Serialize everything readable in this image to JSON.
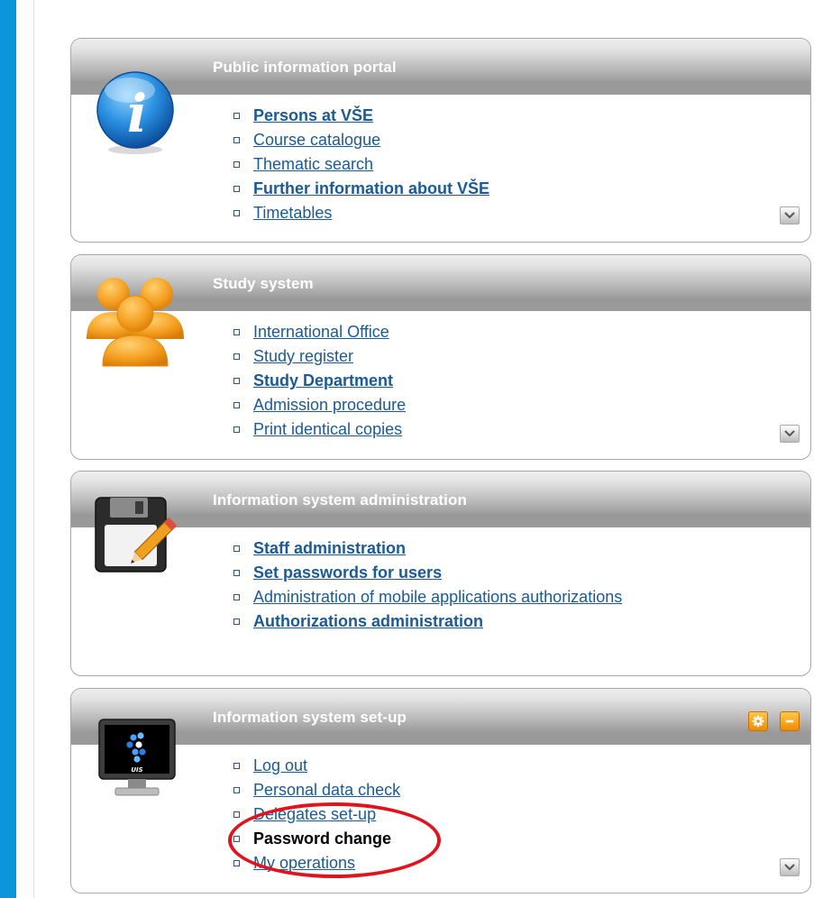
{
  "panels": [
    {
      "title": "Public information portal",
      "icon": "info-icon",
      "links": [
        {
          "label": "Persons at VŠE",
          "bold": true
        },
        {
          "label": "Course catalogue",
          "bold": false
        },
        {
          "label": "Thematic search",
          "bold": false
        },
        {
          "label": "Further information about VŠE",
          "bold": true
        },
        {
          "label": "Timetables",
          "bold": false
        }
      ]
    },
    {
      "title": "Study system",
      "icon": "users-icon",
      "links": [
        {
          "label": "International Office",
          "bold": false
        },
        {
          "label": "Study register",
          "bold": false
        },
        {
          "label": "Study Department",
          "bold": true
        },
        {
          "label": "Admission procedure",
          "bold": false
        },
        {
          "label": "Print identical copies",
          "bold": false
        }
      ]
    },
    {
      "title": "Information system administration",
      "icon": "floppy-edit-icon",
      "links": [
        {
          "label": "Staff administration",
          "bold": true
        },
        {
          "label": "Set passwords for users",
          "bold": true
        },
        {
          "label": "Administration of mobile applications authorizations",
          "bold": false
        },
        {
          "label": "Authorizations administration",
          "bold": true
        }
      ]
    },
    {
      "title": "Information system set-up",
      "icon": "monitor-is-icon",
      "monitor_text": "UIS",
      "links": [
        {
          "label": "Log out",
          "bold": false
        },
        {
          "label": "Personal data check",
          "bold": false
        },
        {
          "label": "Delegates set-up",
          "bold": false
        },
        {
          "label": "Password change",
          "bold": true,
          "current": true
        },
        {
          "label": "My operations",
          "bold": false
        }
      ]
    }
  ],
  "colors": {
    "page_background": "#0b96dc",
    "link": "#1a5a96",
    "header_text": "#ffffff",
    "highlight": "#e0141e",
    "action_button": "#f59a12"
  }
}
